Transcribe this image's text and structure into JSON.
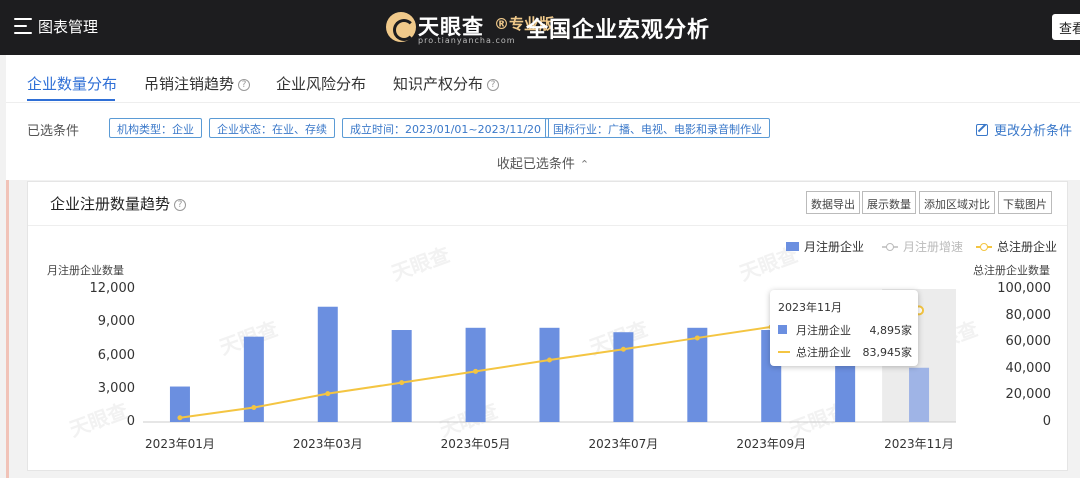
{
  "topbar": {
    "crumb": "图表管理",
    "brand_name": "天眼查",
    "brand_sub": "®专业版",
    "brand_url": "pro.tianyancha.com",
    "brand_title": "全国企业宏观分析",
    "view_button": "查看"
  },
  "tabs": [
    {
      "label": "企业数量分布",
      "active": true,
      "help": false
    },
    {
      "label": "吊销注销趋势",
      "active": false,
      "help": true
    },
    {
      "label": "企业风险分布",
      "active": false,
      "help": false
    },
    {
      "label": "知识产权分布",
      "active": false,
      "help": true
    }
  ],
  "conditions": {
    "label": "已选条件",
    "tags": [
      "机构类型：企业",
      "企业状态：在业、存续",
      "成立时间：2023/01/01~2023/11/20",
      "国标行业：广播、电视、电影和录音制作业"
    ],
    "edit_label": "更改分析条件",
    "collapse_label": "收起已选条件",
    "collapse_chevron": "⌃"
  },
  "card": {
    "title": "企业注册数量趋势",
    "tools": [
      "数据导出",
      "展示数量",
      "添加区域对比",
      "下载图片"
    ],
    "watermark": "天眼查"
  },
  "chart_data": {
    "type": "bar",
    "categories": [
      "2023年01月",
      "2023年02月",
      "2023年03月",
      "2023年04月",
      "2023年05月",
      "2023年06月",
      "2023年07月",
      "2023年08月",
      "2023年09月",
      "2023年10月",
      "2023年11月"
    ],
    "x_tick_labels": [
      "2023年01月",
      "2023年03月",
      "2023年05月",
      "2023年07月",
      "2023年09月",
      "2023年11月"
    ],
    "series": [
      {
        "name": "月注册企业",
        "axis": "left",
        "kind": "bar",
        "color": "#6b8fe0",
        "values": [
          3200,
          7700,
          10400,
          8300,
          8500,
          8500,
          8100,
          8500,
          8300,
          8200,
          4895
        ]
      },
      {
        "name": "月注册增速",
        "axis": "none",
        "kind": "line",
        "color": "#cccccc",
        "hidden": true,
        "values": []
      },
      {
        "name": "总注册企业",
        "axis": "right",
        "kind": "line",
        "color": "#f4c542",
        "values": [
          3200,
          10900,
          21300,
          29600,
          38100,
          46600,
          54700,
          63200,
          71500,
          79050,
          83945
        ]
      }
    ],
    "ylabel_left": "月注册企业数量",
    "ylabel_right": "总注册企业数量",
    "ylim_left": [
      0,
      12000
    ],
    "yticks_left": [
      "12,000",
      "9,000",
      "6,000",
      "3,000",
      "0"
    ],
    "ylim_right": [
      0,
      100000
    ],
    "yticks_right": [
      "100,000",
      "80,000",
      "60,000",
      "40,000",
      "20,000",
      "0"
    ],
    "highlight_category": "2023年11月",
    "grid": false,
    "legend_position": "top-right",
    "tooltip": {
      "title": "2023年11月",
      "rows": [
        {
          "name": "月注册企业",
          "value": "4,895家"
        },
        {
          "name": "总注册企业",
          "value": "83,945家"
        }
      ]
    }
  }
}
